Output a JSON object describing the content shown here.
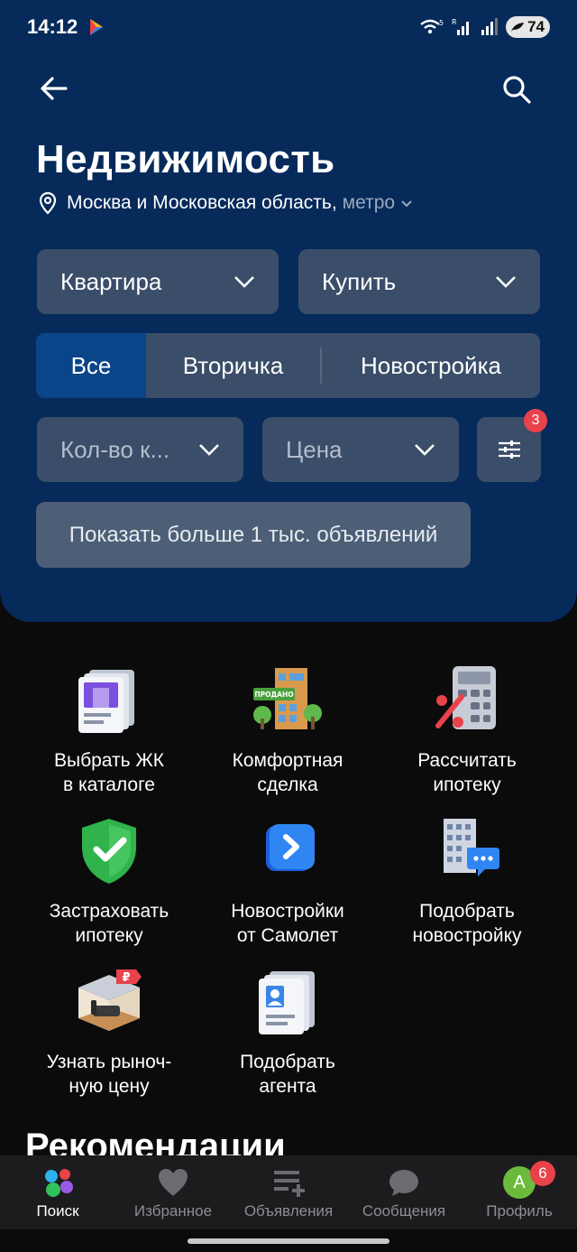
{
  "status": {
    "time": "14:12",
    "signal_tags": [
      "5",
      "R"
    ],
    "battery": "74"
  },
  "header": {
    "title": "Недвижимость",
    "location": "Москва и Московская область,",
    "metro": "метро"
  },
  "filters": {
    "type": "Квартира",
    "deal": "Купить",
    "segments": [
      "Все",
      "Вторичка",
      "Новостройка"
    ],
    "active_segment": "Все",
    "rooms": "Кол-во к...",
    "price": "Цена",
    "filter_count": "3",
    "show_button": "Показать больше 1 тыс. объявлений"
  },
  "tiles": [
    {
      "label": "Выбрать ЖК\nв каталоге",
      "icon": "catalog-building-icon"
    },
    {
      "label": "Комфортная\nсделка",
      "icon": "sold-building-icon",
      "sign": "ПРОДАНО"
    },
    {
      "label": "Рассчитать\nипотеку",
      "icon": "calculator-icon"
    },
    {
      "label": "Застраховать\nипотеку",
      "icon": "shield-check-icon"
    },
    {
      "label": "Новостройки\nот Самолет",
      "icon": "samolet-logo-icon"
    },
    {
      "label": "Подобрать\nновостройку",
      "icon": "building-chat-icon"
    },
    {
      "label": "Узнать рыноч-\nную цену",
      "icon": "room-price-icon"
    },
    {
      "label": "Подобрать\nагента",
      "icon": "agent-card-icon"
    }
  ],
  "recommendations_title": "Рекомендации",
  "bottom_nav": {
    "items": [
      "Поиск",
      "Избранное",
      "Объявления",
      "Сообщения",
      "Профиль"
    ],
    "active": "Поиск",
    "avatar_letter": "A",
    "profile_badge": "6"
  }
}
